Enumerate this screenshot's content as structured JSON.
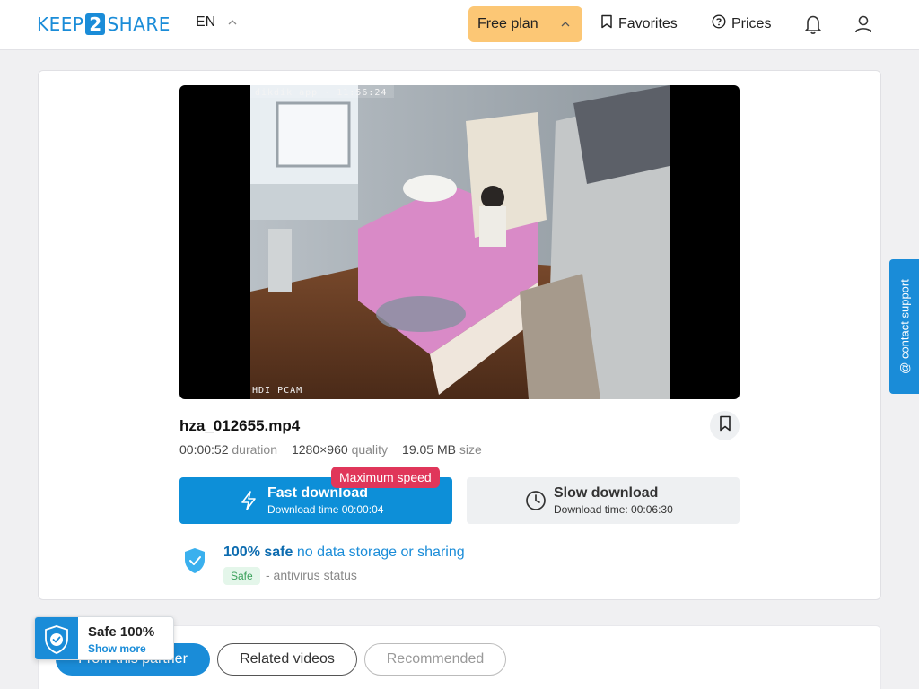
{
  "header": {
    "logo": {
      "pre": "KEEP",
      "num": "2",
      "post": "SHARE"
    },
    "lang": "EN",
    "plan_label": "Free plan",
    "favorites_label": "Favorites",
    "prices_label": "Prices",
    "icons": {
      "lang_chevron": "chevron-up-icon",
      "plan_chevron": "chevron-up-icon",
      "favorites": "bookmark-icon",
      "prices": "help-circle-icon",
      "notifications": "bell-icon",
      "account": "user-icon"
    }
  },
  "player": {
    "cam_stamp": "dikdik app  ·  11:56:24",
    "cam_brand": "HDI PCAM"
  },
  "file": {
    "name": "hza_012655.mp4",
    "duration_value": "00:00:52",
    "duration_label": "duration",
    "quality_value": "1280×960",
    "quality_label": "quality",
    "size_value": "19.05 MB",
    "size_label": "size"
  },
  "download": {
    "fast_title": "Fast download",
    "fast_subtitle": "Download time 00:00:04",
    "max_badge": "Maximum speed",
    "slow_title": "Slow download",
    "slow_subtitle": "Download time: 00:06:30"
  },
  "safety": {
    "strong": "100% safe",
    "rest": "no data storage or sharing",
    "badge": "Safe",
    "status": "- antivirus status"
  },
  "support": {
    "label": "@ contact support"
  },
  "tabs": [
    {
      "label": "From this partner"
    },
    {
      "label": "Related videos"
    },
    {
      "label": "Recommended"
    }
  ],
  "safe_widget": {
    "title": "Safe 100%",
    "link": "Show more"
  },
  "colors": {
    "accent": "#1a8cd8",
    "plan": "#fcc775",
    "badge": "#e0365a",
    "safe_green": "#3aa15a"
  }
}
